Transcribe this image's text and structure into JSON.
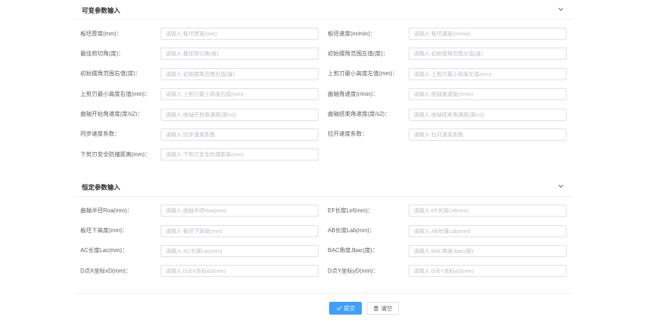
{
  "variable_section": {
    "title": "可变参数输入",
    "fields": [
      {
        "label": "板坯厚度(mm)：",
        "placeholder": "请输入 板坯厚度(mm)",
        "value": ""
      },
      {
        "label": "板坯速度(m/min)：",
        "placeholder": "请输入 板坯速度(m/min)",
        "value": ""
      },
      {
        "label": "最佳剪切角(度)：",
        "placeholder": "请输入 最佳剪切角(度)",
        "value": ""
      },
      {
        "label": "初始摆角范围左值(度)：",
        "placeholder": "请输入 初始摆角范围左值(度)",
        "value": ""
      },
      {
        "label": "初始摆角范围右值(度)：",
        "placeholder": "请输入 初始摆角范围右值(度)",
        "value": ""
      },
      {
        "label": "上剪刃最小高度左值(mm)：",
        "placeholder": "请输入 上剪刃最小高度左值(mm)",
        "value": ""
      },
      {
        "label": "上剪刃最小高度右值(mm)：",
        "placeholder": "请输入 上剪刃最小高度右值(mm)",
        "value": ""
      },
      {
        "label": "曲轴角速度(r/min)：",
        "placeholder": "请输入 曲轴角速度(r/min)",
        "value": ""
      },
      {
        "label": "曲轴开始角速度(度/s2)：",
        "placeholder": "请输入 曲轴开始角速度(度/s2)",
        "value": ""
      },
      {
        "label": "曲轴结束角速度(度/s2)：",
        "placeholder": "请输入 曲轴结束角速度(度/s2)",
        "value": ""
      },
      {
        "label": "同步速度系数：",
        "placeholder": "请输入 同步速度系数",
        "value": ""
      },
      {
        "label": "拉开速度系数：",
        "placeholder": "请输入 拉开速度系数",
        "value": ""
      },
      {
        "label": "下剪刃安全防撞距离(mm)：",
        "placeholder": "请输入 下剪刃安全防撞距离(mm)",
        "value": ""
      }
    ]
  },
  "fixed_section": {
    "title": "恒定参数输入",
    "fields": [
      {
        "label": "曲轴半径Roa(mm)：",
        "placeholder": "请输入 曲轴半径Roa(mm)",
        "value": ""
      },
      {
        "label": "EF长度Lef(mm)：",
        "placeholder": "请输入 EF长度Lef(mm)",
        "value": ""
      },
      {
        "label": "板坯下高度(mm)：",
        "placeholder": "请输入 板坯下高度(mm)",
        "value": ""
      },
      {
        "label": "AB长度Lab(mm)：",
        "placeholder": "请输入 AB长度Lab(mm)",
        "value": ""
      },
      {
        "label": "AC长度Lac(mm)：",
        "placeholder": "请输入 AC长度Lac(mm)",
        "value": ""
      },
      {
        "label": "BAC角度Jbac(度)：",
        "placeholder": "请输入 BAC角度Jbac(度)",
        "value": ""
      },
      {
        "label": "D点X坐标xD(mm)：",
        "placeholder": "请输入 D点X坐标xD(mm)",
        "value": ""
      },
      {
        "label": "D点Y坐标yD(mm)：",
        "placeholder": "请输入 D点Y坐标yD(mm)",
        "value": ""
      }
    ]
  },
  "actions": {
    "submit_label": "提交",
    "clear_label": "清空",
    "accent_color": "#409eff"
  },
  "icons": {
    "collapse": "chevron-down-icon",
    "submit": "check-icon",
    "clear": "delete-icon"
  }
}
